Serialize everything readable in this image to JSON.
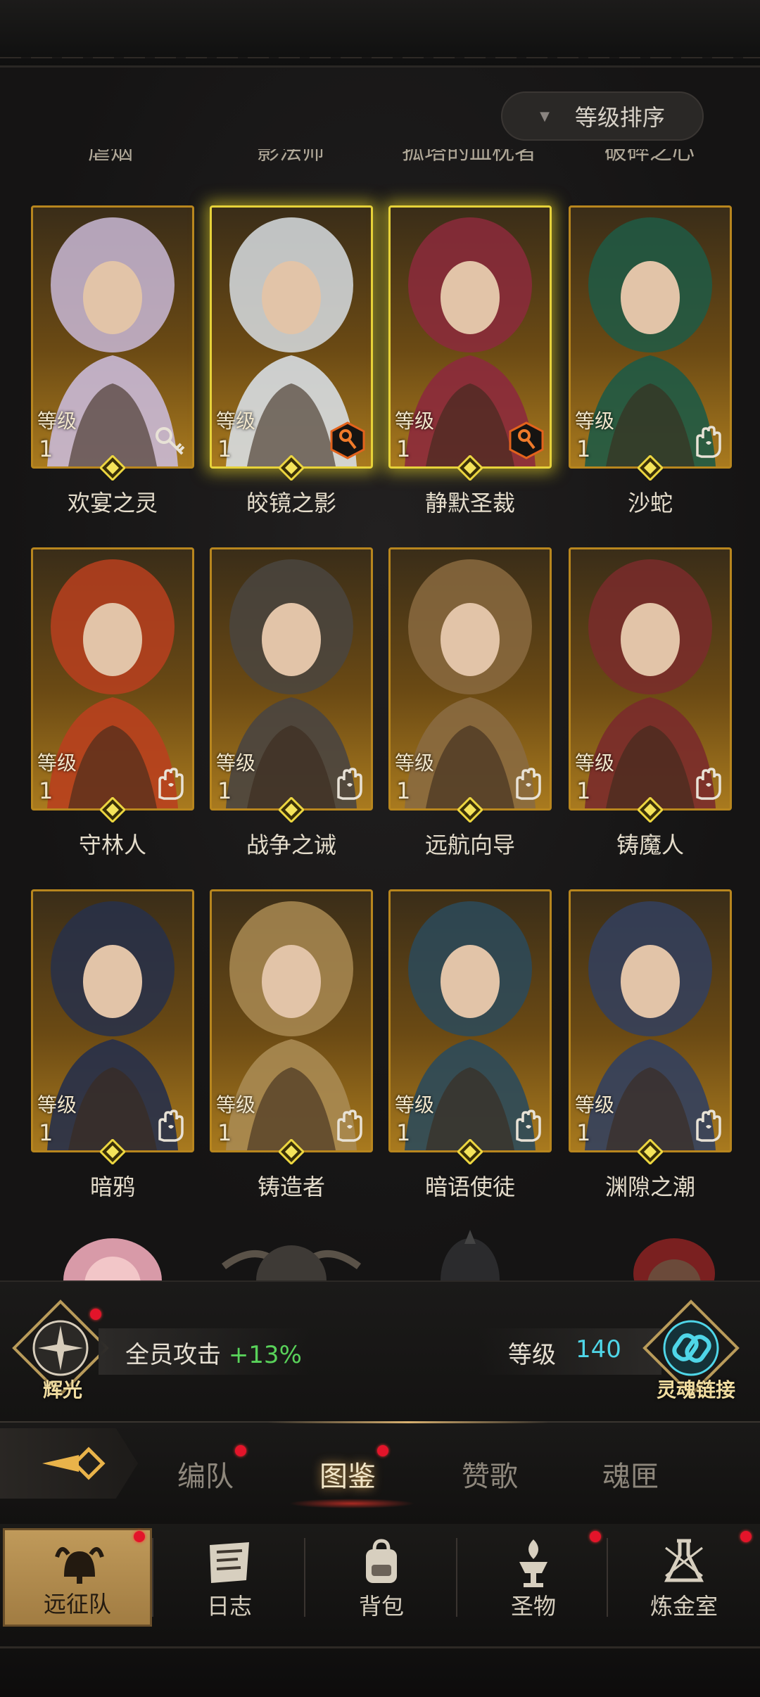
{
  "sort": {
    "label": "等级排序"
  },
  "top_row_cut_names": [
    "虐烟",
    "影法师",
    "孤塔的血枕者",
    "破碎之心"
  ],
  "level_label": "等级",
  "heroes": [
    {
      "name": "欢宴之灵",
      "level": "1",
      "class_icon": "key-icon",
      "highlight": false,
      "theme": "#c9b9d6"
    },
    {
      "name": "皎镜之影",
      "level": "1",
      "class_icon": "orange-key-badge-icon",
      "highlight": true,
      "theme": "#d7dde2"
    },
    {
      "name": "静默圣裁",
      "level": "1",
      "class_icon": "orange-key-badge-icon",
      "highlight": true,
      "theme": "#8c2a3c"
    },
    {
      "name": "沙蛇",
      "level": "1",
      "class_icon": "hand-icon",
      "highlight": false,
      "theme": "#1f5a45"
    },
    {
      "name": "守林人",
      "level": "1",
      "class_icon": "hand-icon",
      "highlight": false,
      "theme": "#b8401e"
    },
    {
      "name": "战争之诫",
      "level": "1",
      "class_icon": "hand-icon",
      "highlight": false,
      "theme": "#4a4540"
    },
    {
      "name": "远航向导",
      "level": "1",
      "class_icon": "hand-icon",
      "highlight": false,
      "theme": "#8a6a40"
    },
    {
      "name": "铸魔人",
      "level": "1",
      "class_icon": "hand-icon",
      "highlight": false,
      "theme": "#7a2b2b"
    },
    {
      "name": "暗鸦",
      "level": "1",
      "class_icon": "hand-icon",
      "highlight": false,
      "theme": "#27304a"
    },
    {
      "name": "铸造者",
      "level": "1",
      "class_icon": "hand-icon",
      "highlight": false,
      "theme": "#a98a52"
    },
    {
      "name": "暗语使徒",
      "level": "1",
      "class_icon": "hand-icon",
      "highlight": false,
      "theme": "#2c4a5a"
    },
    {
      "name": "渊隙之潮",
      "level": "1",
      "class_icon": "hand-icon",
      "highlight": false,
      "theme": "#33405e"
    }
  ],
  "stats": {
    "radiance_label": "辉光",
    "attack_label": "全员攻击",
    "attack_value": "+13%",
    "level_label": "等级",
    "level_value": "140",
    "soul_link_label": "灵魂链接"
  },
  "tabs": [
    {
      "label": "编队",
      "active": false,
      "dot": true
    },
    {
      "label": "图鉴",
      "active": true,
      "dot": true
    },
    {
      "label": "赞歌",
      "active": false,
      "dot": false
    },
    {
      "label": "魂匣",
      "active": false,
      "dot": false
    }
  ],
  "nav": [
    {
      "label": "远征队",
      "icon": "viking-helmet-icon",
      "active": true,
      "dot": true
    },
    {
      "label": "日志",
      "icon": "map-scroll-icon",
      "active": false,
      "dot": false
    },
    {
      "label": "背包",
      "icon": "backpack-icon",
      "active": false,
      "dot": false
    },
    {
      "label": "圣物",
      "icon": "brazier-icon",
      "active": false,
      "dot": true
    },
    {
      "label": "炼金室",
      "icon": "alchemy-icon",
      "active": false,
      "dot": true
    }
  ],
  "colors": {
    "accent_gold": "#b8861e",
    "attack_green": "#59d25a",
    "level_cyan": "#4fd6e8",
    "notify_red": "#e3142a"
  }
}
